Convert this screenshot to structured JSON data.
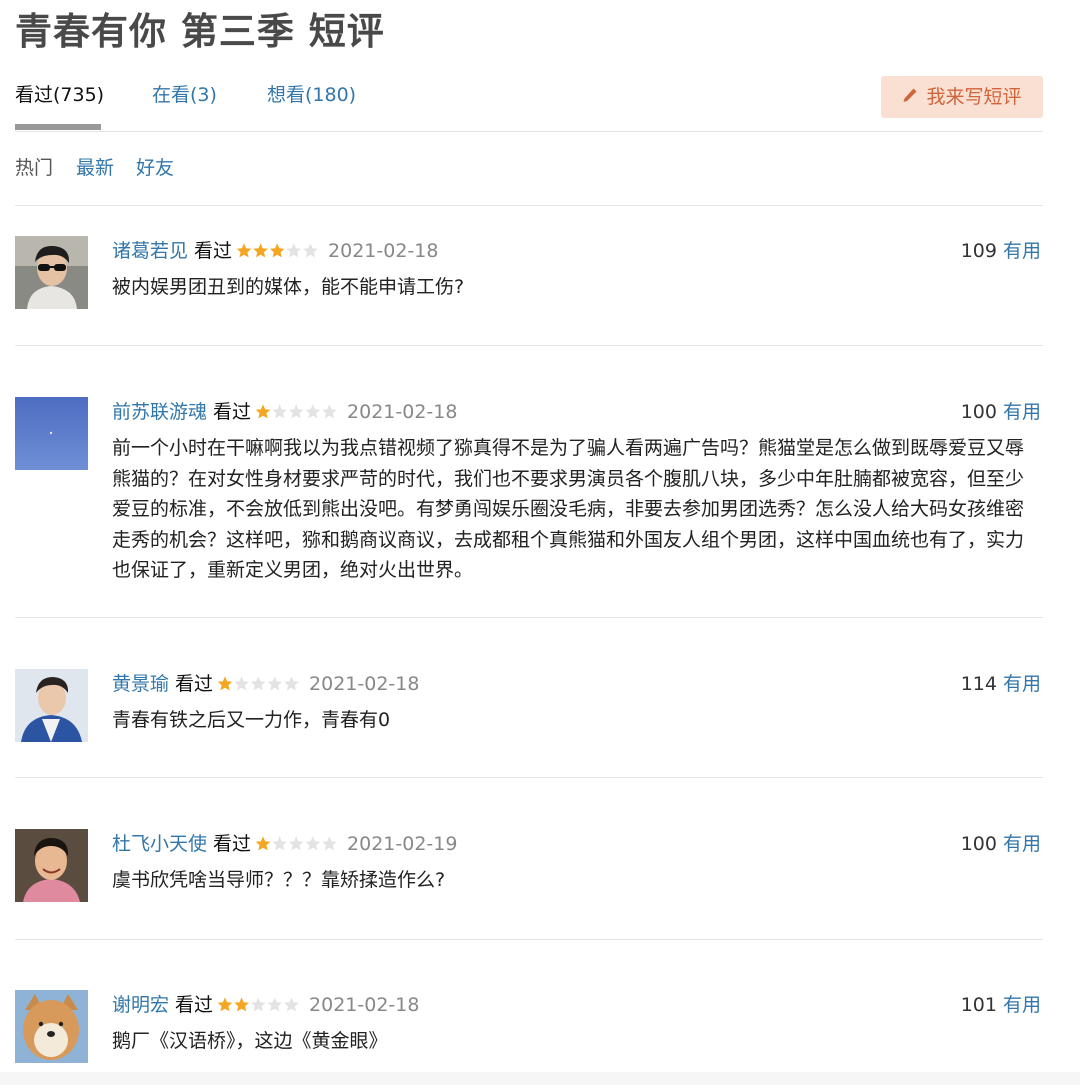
{
  "title": "青春有你 第三季 短评",
  "tabs": [
    {
      "label": "看过(735)",
      "active": true
    },
    {
      "label": "在看(3)",
      "active": false
    },
    {
      "label": "想看(180)",
      "active": false
    }
  ],
  "write_button": {
    "label": "我来写短评",
    "icon": "pencil-icon"
  },
  "sort_options": [
    {
      "label": "热门",
      "active": true
    },
    {
      "label": "最新",
      "active": false
    },
    {
      "label": "好友",
      "active": false
    }
  ],
  "star_colors": {
    "filled": "#f5a623",
    "empty": "#e3e3e3"
  },
  "comments": [
    {
      "user": "诸葛若见",
      "status": "看过",
      "rating": 3,
      "date": "2021-02-18",
      "votes": "109",
      "useful_label": "有用",
      "content": "被内娱男团丑到的媒体，能不能申请工伤?",
      "avatar": "avatar-sunglasses-man"
    },
    {
      "user": "前苏联游魂",
      "status": "看过",
      "rating": 1,
      "date": "2021-02-18",
      "votes": "100",
      "useful_label": "有用",
      "content": "前一个小时在干嘛啊我以为我点错视频了猕真得不是为了骗人看两遍广告吗？熊猫堂是怎么做到既辱爱豆又辱熊猫的？在对女性身材要求严苛的时代，我们也不要求男演员各个腹肌八块，多少中年肚腩都被宽容，但至少爱豆的标准，不会放低到熊出没吧。有梦勇闯娱乐圈没毛病，非要去参加男团选秀？怎么没人给大码女孩维密走秀的机会？这样吧，猕和鹅商议商议，去成都租个真熊猫和外国友人组个男团，这样中国血统也有了，实力也保证了，重新定义男团，绝对火出世界。",
      "avatar": "avatar-blue-sky"
    },
    {
      "user": "黄景瑜",
      "status": "看过",
      "rating": 1,
      "date": "2021-02-18",
      "votes": "114",
      "useful_label": "有用",
      "content": "青春有铁之后又一力作，青春有0",
      "avatar": "avatar-man-jacket"
    },
    {
      "user": "杜飞小天使",
      "status": "看过",
      "rating": 1,
      "date": "2021-02-19",
      "votes": "100",
      "useful_label": "有用",
      "content": "虞书欣凭啥当导师？？？靠矫揉造作么?",
      "avatar": "avatar-smiling-man"
    },
    {
      "user": "谢明宏",
      "status": "看过",
      "rating": 2,
      "date": "2021-02-18",
      "votes": "101",
      "useful_label": "有用",
      "content": "鹅厂《汉语桥》，这边《黄金眼》",
      "avatar": "avatar-shiba-dog"
    }
  ]
}
